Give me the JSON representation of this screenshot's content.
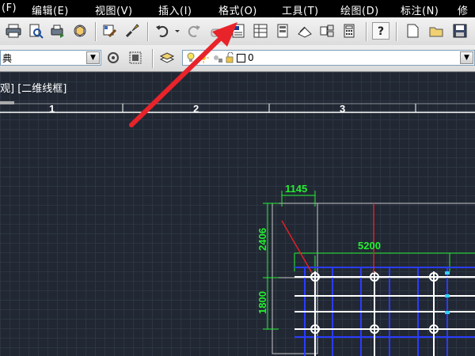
{
  "menubar": {
    "items": [
      {
        "label": "(F)",
        "name": "menu-file"
      },
      {
        "label": "编辑(E)",
        "name": "menu-edit"
      },
      {
        "label": "视图(V)",
        "name": "menu-view"
      },
      {
        "label": "插入(I)",
        "name": "menu-insert"
      },
      {
        "label": "格式(O)",
        "name": "menu-format"
      },
      {
        "label": "工具(T)",
        "name": "menu-tools"
      },
      {
        "label": "绘图(D)",
        "name": "menu-draw"
      },
      {
        "label": "标注(N)",
        "name": "menu-dimension"
      },
      {
        "label": "修",
        "name": "menu-modify"
      }
    ]
  },
  "toolbar2": {
    "style_combo_value": "典",
    "layer_combo_value": "0"
  },
  "viewport": {
    "label": "观] [二维线框]"
  },
  "columns": [
    "1",
    "2",
    "3"
  ],
  "dimensions": {
    "width_top": "1145",
    "height_top": "2406",
    "span": "5200",
    "height_bottom": "1800"
  },
  "colors": {
    "annotation_arrow": "#e8232a",
    "dimension": "#22f030",
    "grid_blue": "#2a3cff",
    "background": "#212833"
  }
}
